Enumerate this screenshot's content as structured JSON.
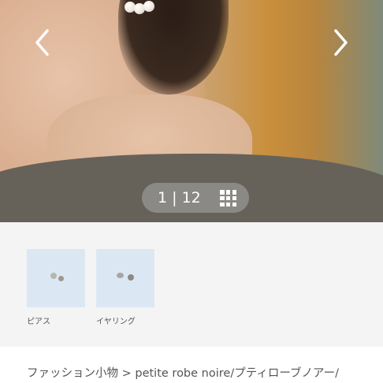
{
  "gallery": {
    "current": "1",
    "separator": "|",
    "total": "12",
    "prev_icon": "chevron-left-icon",
    "next_icon": "chevron-right-icon",
    "grid_icon": "grid-icon"
  },
  "variants": [
    {
      "label": "ピアス"
    },
    {
      "label": "イヤリング"
    }
  ],
  "breadcrumb": "ファッション小物 > petite robe noire/プティローブノアー/"
}
